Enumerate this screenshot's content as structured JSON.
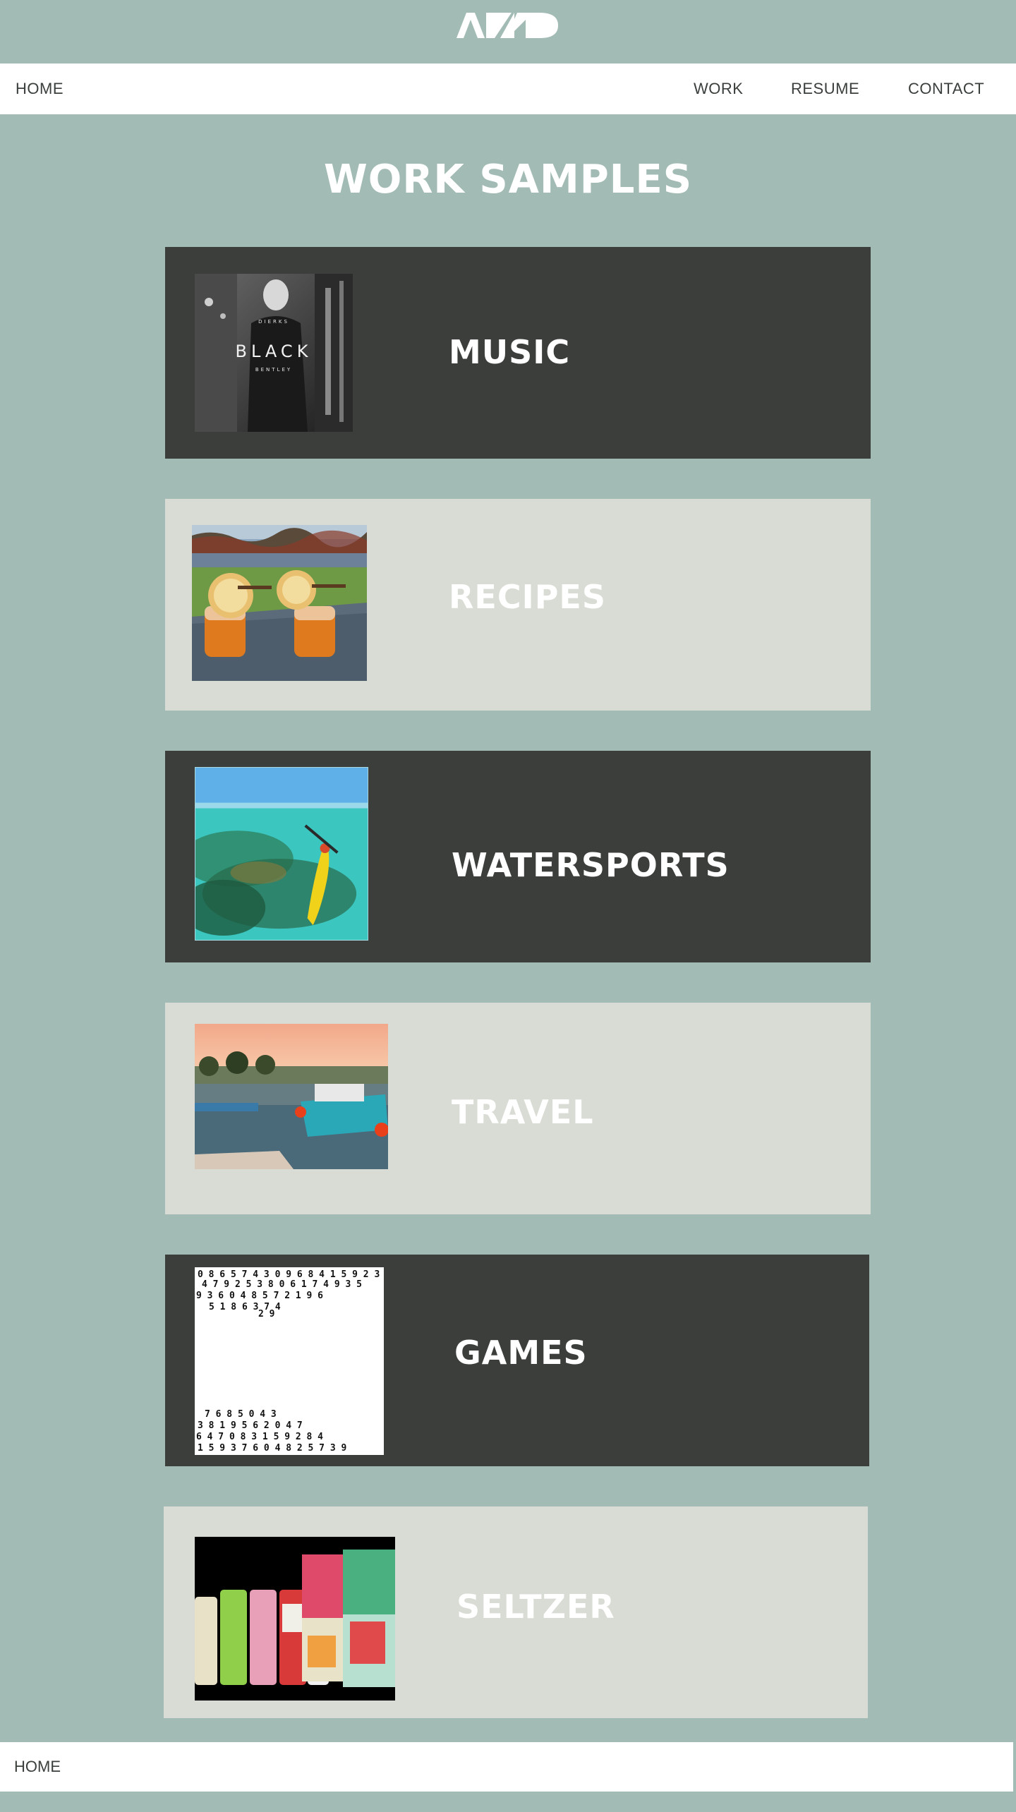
{
  "header": {
    "logo_text": "AZZD"
  },
  "nav": {
    "home": "HOME",
    "work": "WORK",
    "resume": "RESUME",
    "contact": "CONTACT"
  },
  "main": {
    "title": "WORK SAMPLES",
    "cards": [
      {
        "label": "MUSIC",
        "image": "album-cover-image",
        "image_text": [
          "DIERKS",
          "BLACK",
          "BENTLEY"
        ]
      },
      {
        "label": "RECIPES",
        "image": "cocktail-drinks-image"
      },
      {
        "label": "WATERSPORTS",
        "image": "kayak-image"
      },
      {
        "label": "TRAVEL",
        "image": "harbor-boats-image"
      },
      {
        "label": "GAMES",
        "image": "falling-numbers-image"
      },
      {
        "label": "SELTZER",
        "image": "seltzer-cans-image"
      }
    ]
  },
  "footer": {
    "home": "HOME"
  },
  "colors": {
    "background": "#a2bbb4",
    "dark_card": "#3b3e3b",
    "light_card": "#d9dcd4",
    "nav_bg": "#ffffff"
  }
}
